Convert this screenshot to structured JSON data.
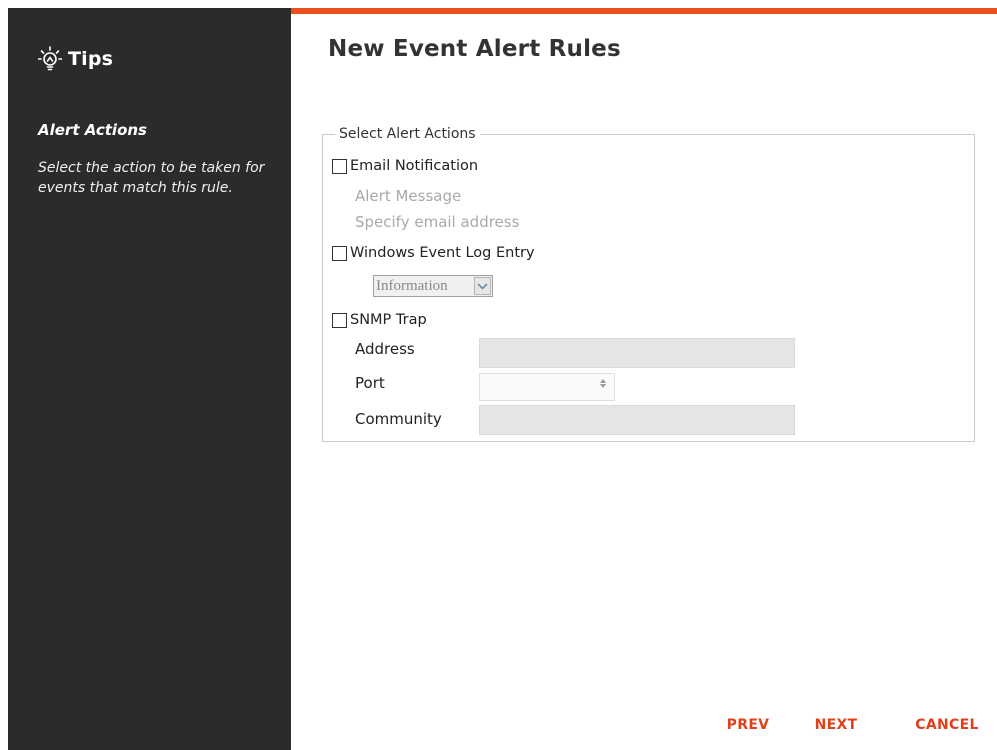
{
  "sidebar": {
    "title": "Tips",
    "heading": "Alert Actions",
    "body": "Select the action to be taken for events that match this rule."
  },
  "page": {
    "title": "New Event Alert Rules"
  },
  "alert_actions": {
    "legend": "Select Alert Actions",
    "email": {
      "label": "Email Notification",
      "checked": false,
      "alert_message_label": "Alert Message",
      "email_address_label": "Specify email address"
    },
    "windows_log": {
      "label": "Windows Event Log Entry",
      "checked": false,
      "level_selected": "Information"
    },
    "snmp": {
      "label": "SNMP Trap",
      "checked": false,
      "address_label": "Address",
      "address_value": "",
      "port_label": "Port",
      "port_value": "",
      "community_label": "Community",
      "community_value": ""
    }
  },
  "footer": {
    "prev": "PREV",
    "next": "NEXT",
    "cancel": "CANCEL"
  },
  "colors": {
    "accent": "#ec4e1e",
    "sidebar_bg": "#2b2b2b",
    "button_text": "#e0401a"
  }
}
